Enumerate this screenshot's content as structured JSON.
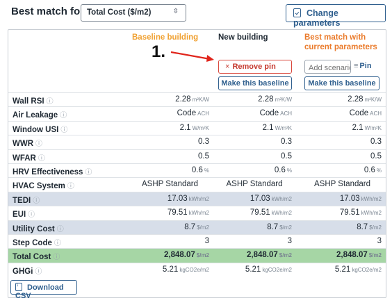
{
  "header": {
    "best_match_label": "Best match for",
    "metric_selected": "Total Cost ($/m2)",
    "change_parameters_label": "Change parameters"
  },
  "columns": {
    "baseline": "Baseline building",
    "new": "New building",
    "best": "Best match with current parameters"
  },
  "annotation": {
    "number": "1."
  },
  "actions": {
    "remove_pin": "Remove pin",
    "make_baseline": "Make this baseline",
    "scenario_placeholder": "Add scenario name",
    "pin": "Pin"
  },
  "rows": [
    {
      "label": "Wall RSI",
      "style": "plain",
      "values": [
        "2.28",
        "2.28",
        "2.28"
      ],
      "unit": "m²K/W"
    },
    {
      "label": "Air Leakage",
      "style": "plain",
      "values": [
        "Code",
        "Code",
        "Code"
      ],
      "unit": "ACH"
    },
    {
      "label": "Window USI",
      "style": "plain",
      "values": [
        "2.1",
        "2.1",
        "2.1"
      ],
      "unit": "W/m²K"
    },
    {
      "label": "WWR",
      "style": "plain",
      "values": [
        "0.3",
        "0.3",
        "0.3"
      ],
      "unit": ""
    },
    {
      "label": "WFAR",
      "style": "plain",
      "values": [
        "0.5",
        "0.5",
        "0.5"
      ],
      "unit": ""
    },
    {
      "label": "HRV Effectiveness",
      "style": "plain",
      "values": [
        "0.6",
        "0.6",
        "0.6"
      ],
      "unit": "%"
    },
    {
      "label": "HVAC System",
      "style": "center",
      "values": [
        "ASHP Standard",
        "ASHP Standard",
        "ASHP Standard"
      ],
      "unit": ""
    },
    {
      "label": "TEDI",
      "style": "blue",
      "values": [
        "17.03",
        "17.03",
        "17.03"
      ],
      "unit": "kWh/m2"
    },
    {
      "label": "EUI",
      "style": "plain",
      "values": [
        "79.51",
        "79.51",
        "79.51"
      ],
      "unit": "kWh/m2"
    },
    {
      "label": "Utility Cost",
      "style": "blue",
      "values": [
        "8.7",
        "8.7",
        "8.7"
      ],
      "unit": "$/m2"
    },
    {
      "label": "Step Code",
      "style": "plain",
      "values": [
        "3",
        "3",
        "3"
      ],
      "unit": ""
    },
    {
      "label": "Total Cost",
      "style": "green",
      "values": [
        "2,848.07",
        "2,848.07",
        "2,848.07"
      ],
      "unit": "$/m2"
    },
    {
      "label": "GHGi",
      "style": "plain",
      "values": [
        "5.21",
        "5.21",
        "5.21"
      ],
      "unit": "kgCO2e/m2"
    }
  ],
  "footer": {
    "download_label": "Download CSV"
  },
  "colors": {
    "accent": "#2f5f8e",
    "baseline": "#f0a132",
    "best": "#ea7a2a",
    "danger": "#c5372c",
    "highlight_blue": "#d7dee9",
    "highlight_green": "#a6d6a5"
  },
  "icons": [
    "chevron-updown-icon",
    "clipboard-check-icon",
    "info-icon",
    "close-icon",
    "pin-icon",
    "download-icon",
    "arrow-annotation"
  ]
}
